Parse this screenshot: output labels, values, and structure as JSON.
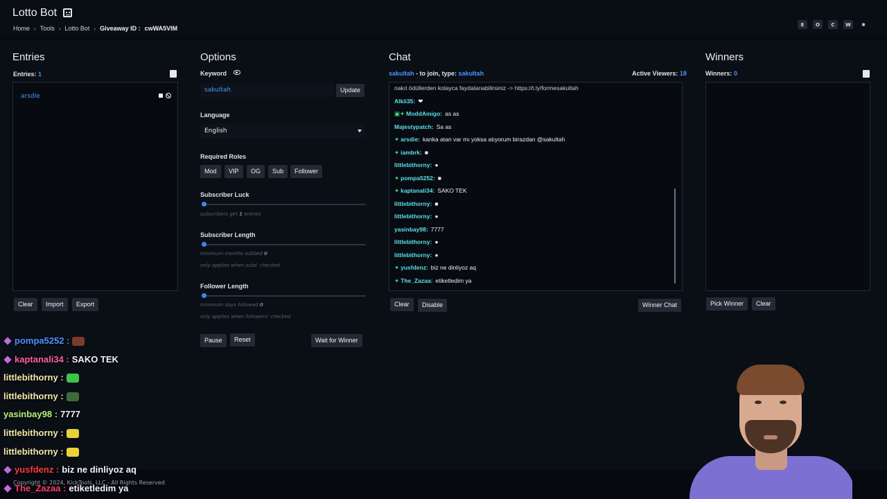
{
  "header": {
    "app_title": "Lotto Bot",
    "breadcrumb": [
      "Home",
      "Tools",
      "Lotto Bot"
    ],
    "giveaway_label": "Giveaway ID :",
    "giveaway_id": "cwWA5VIM",
    "buttons": [
      "E",
      "O",
      "C",
      "W",
      "✱"
    ]
  },
  "entries": {
    "title": "Entries",
    "count_label": "Entries:",
    "count": "1",
    "items": [
      "arsdie"
    ],
    "buttons": {
      "clear": "Clear",
      "import": "Import",
      "export": "Export"
    }
  },
  "options": {
    "title": "Options",
    "keyword_label": "Keyword",
    "keyword_value": "sakultah",
    "update_label": "Update",
    "language_label": "Language",
    "language_value": "English",
    "roles_label": "Required Roles",
    "roles": [
      "Mod",
      "VIP",
      "OG",
      "Sub",
      "Follower"
    ],
    "sub_luck_label": "Subscriber Luck",
    "sub_luck_hint": "subscribers get",
    "sub_luck_value": "1",
    "sub_luck_unit": "entries",
    "sub_luck_level": 0,
    "sub_length_label": "Subscriber Length",
    "sub_length_hint": "minimum months subbed",
    "sub_length_value": "0",
    "sub_length_note": "only applies when subs' checked",
    "sub_length_level": 0,
    "follower_length_label": "Follower Length",
    "follower_length_hint": "minimum days followed",
    "follower_length_value": "0",
    "follower_length_note": "only applies when followers' checked",
    "follower_length_level": 0,
    "pause_label": "Pause",
    "reset_label": "Reset",
    "wait_label": "Wait for Winner"
  },
  "chat": {
    "title": "Chat",
    "join_user": "sakultah",
    "join_text": "- to join, type:",
    "join_keyword": "sakultah",
    "viewers_label": "Active Viewers:",
    "viewers": "18",
    "messages": [
      {
        "user": "",
        "text": "nakıt ödüllerden kolayca faydalanabilirsiniz -> https://t.ly/formesakultah",
        "color": "#cfd3d9",
        "badge": ""
      },
      {
        "user": "Alkii35:",
        "text": "❤",
        "color": "#59e0e6",
        "badge": ""
      },
      {
        "user": "ModdAmigo:",
        "text": "as as",
        "color": "#59e0e6",
        "badge": "▣✦"
      },
      {
        "user": "Majestypatch:",
        "text": "Sa as",
        "color": "#59e0e6",
        "badge": ""
      },
      {
        "user": "arsdie:",
        "text": "kanka atan var mı yoksa atıyorum birazdan @sakultah",
        "color": "#59e0e6",
        "badge": "✦"
      },
      {
        "user": "iambrk:",
        "text": "■",
        "color": "#59e0e6",
        "badge": "✦"
      },
      {
        "user": "littlebithorny:",
        "text": "●",
        "color": "#59e0e6",
        "badge": ""
      },
      {
        "user": "pompa5252:",
        "text": "■",
        "color": "#59e0e6",
        "badge": "✦"
      },
      {
        "user": "kaptanali34:",
        "text": "SAKO TEK",
        "color": "#59e0e6",
        "badge": "✦"
      },
      {
        "user": "littlebithorny:",
        "text": "■",
        "color": "#59e0e6",
        "badge": ""
      },
      {
        "user": "littlebithorny:",
        "text": "●",
        "color": "#59e0e6",
        "badge": ""
      },
      {
        "user": "yasinbay98:",
        "text": "7777",
        "color": "#59e0e6",
        "badge": ""
      },
      {
        "user": "littlebithorny:",
        "text": "●",
        "color": "#59e0e6",
        "badge": ""
      },
      {
        "user": "littlebithorny:",
        "text": "●",
        "color": "#59e0e6",
        "badge": ""
      },
      {
        "user": "yusfdenz:",
        "text": "biz ne dinliyoz aq",
        "color": "#59e0e6",
        "badge": "✦"
      },
      {
        "user": "The_Zazaa:",
        "text": "etiketledim ya",
        "color": "#59e0e6",
        "badge": "✦"
      }
    ],
    "buttons": {
      "clear": "Clear",
      "disable": "Disable",
      "winner_chat": "Winner Chat"
    }
  },
  "winners": {
    "title": "Winners",
    "count_label": "Winners:",
    "count": "0",
    "buttons": {
      "pick": "Pick Winner",
      "clear": "Clear"
    }
  },
  "overlay_chat": [
    {
      "user": "pompa5252 :",
      "text": "",
      "color": "#4a95ff",
      "diamond": true,
      "emote": "#7a3b2b"
    },
    {
      "user": "kaptanali34 :",
      "text": "SAKO TEK",
      "color": "#ff5fa3",
      "diamond": true,
      "emote": ""
    },
    {
      "user": "littlebithorny :",
      "text": "",
      "color": "#f4e9a8",
      "diamond": false,
      "emote": "#3ec34b"
    },
    {
      "user": "littlebithorny :",
      "text": "",
      "color": "#f4e9a8",
      "diamond": false,
      "emote": "#3f6b3a"
    },
    {
      "user": "yasinbay98 :",
      "text": "7777",
      "color": "#b8f27a",
      "diamond": false,
      "emote": ""
    },
    {
      "user": "littlebithorny :",
      "text": "",
      "color": "#f4e9a8",
      "diamond": false,
      "emote": "#e8d23a"
    },
    {
      "user": "littlebithorny :",
      "text": "",
      "color": "#f4e9a8",
      "diamond": false,
      "emote": "#e8d23a"
    },
    {
      "user": "yusfdenz :",
      "text": "biz ne dinliyoz aq",
      "color": "#ff3b3b",
      "diamond": true,
      "emote": ""
    },
    {
      "user": "The_Zazaa :",
      "text": "etiketledim ya",
      "color": "#ff3b6b",
      "diamond": true,
      "emote": ""
    }
  ],
  "footer": "Copyright © 2024, KickTools, LLC - All Rights Reserved"
}
